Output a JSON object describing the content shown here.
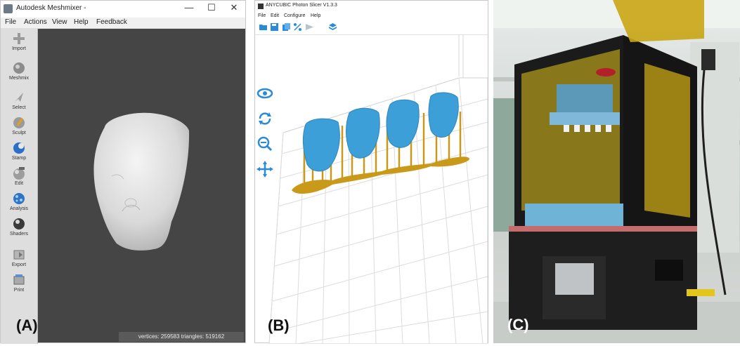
{
  "meshmixer": {
    "title": "Autodesk Meshmixer -",
    "window_controls": {
      "minimize": "—",
      "maximize": "☐",
      "close": "✕"
    },
    "menu": [
      "File",
      "Actions",
      "View",
      "Help",
      "Feedback"
    ],
    "tools": [
      {
        "label": "Import",
        "icon": "plus-icon"
      },
      {
        "label": "Meshmix",
        "icon": "sphere-icon"
      },
      {
        "label": "Select",
        "icon": "cursor-arrow-icon"
      },
      {
        "label": "Sculpt",
        "icon": "brush-icon"
      },
      {
        "label": "Stamp",
        "icon": "stamp-icon"
      },
      {
        "label": "Edit",
        "icon": "edit-sphere-icon"
      },
      {
        "label": "Analysis",
        "icon": "analysis-sphere-icon"
      },
      {
        "label": "Shaders",
        "icon": "shader-sphere-icon"
      },
      {
        "label": "Export",
        "icon": "export-icon"
      },
      {
        "label": "Print",
        "icon": "print-icon"
      }
    ],
    "status": "vertices: 259583 triangles: 519162",
    "viewport_color": "#454545"
  },
  "slicer": {
    "title": "ANYCUBIC Photon Slicer V1.3.3",
    "menu": [
      "File",
      "Edit",
      "Configure",
      "Help"
    ],
    "toolbar_icons": [
      "open-folder-icon",
      "save-icon",
      "copy-icon",
      "percent-icon",
      "slice-arrow-icon",
      "layers-icon"
    ],
    "view_buttons": [
      "eye-icon",
      "rotate-icon",
      "zoom-icon",
      "move-icon"
    ],
    "model_color": "#3d9fd8",
    "support_color": "#c99a1a"
  },
  "labels": {
    "a": "(A)",
    "b": "(B)",
    "c": "(C)"
  },
  "colors": {
    "accent_blue": "#2a8bd6",
    "resin_yellow": "#e3c51b",
    "printer_body": "#1b1b1b"
  }
}
